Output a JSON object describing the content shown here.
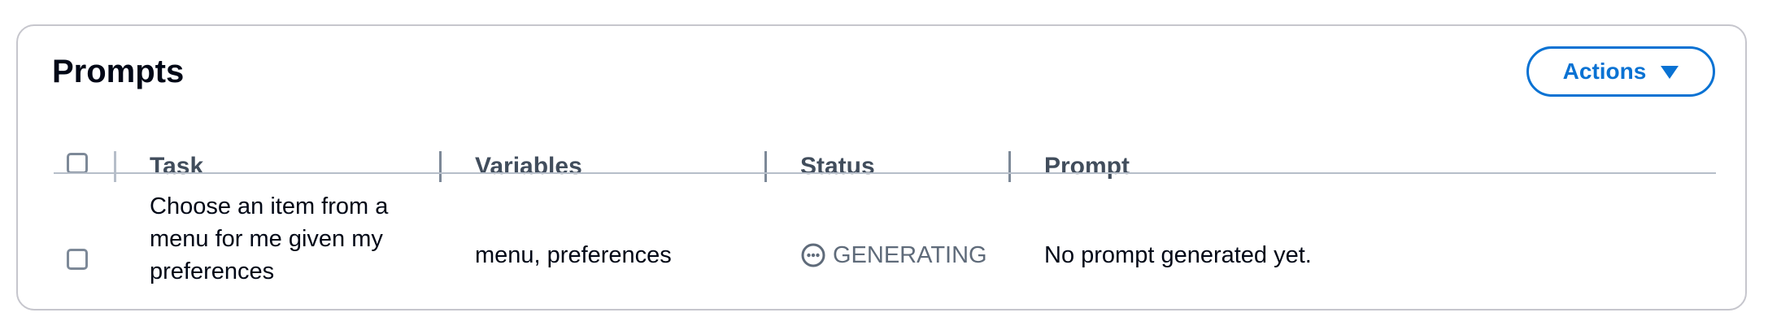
{
  "panel": {
    "title": "Prompts",
    "actions_label": "Actions"
  },
  "table": {
    "columns": [
      "Task",
      "Variables",
      "Status",
      "Prompt"
    ],
    "rows": [
      {
        "task_lines": [
          "Choose an item from a",
          "menu for me given my",
          "preferences"
        ],
        "variables": "menu, preferences",
        "status": "GENERATING",
        "status_icon": "ellipsis-circle-icon",
        "prompt": "No prompt generated yet."
      }
    ]
  },
  "colors": {
    "accent": "#0972d3",
    "text": "#000716",
    "header_text": "#414d5c",
    "status_pending": "#5f6b7a",
    "border": "#c6c6cd"
  }
}
